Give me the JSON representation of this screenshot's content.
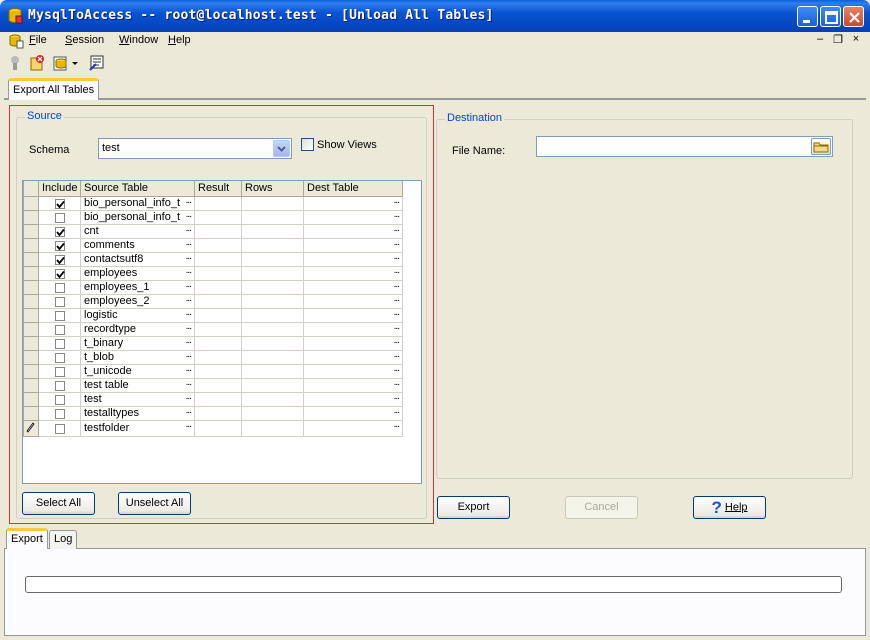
{
  "window": {
    "title": "MysqlToAccess -- root@localhost.test - [Unload All Tables]"
  },
  "menu": {
    "items": [
      "File",
      "Session",
      "Window",
      "Help"
    ],
    "mdi_min": "–",
    "mdi_restore": "❐",
    "mdi_close": "×"
  },
  "toolbar": {
    "icons": [
      "connect-icon",
      "disconnect-icon",
      "new-session-icon",
      "dropdown-arrow-icon",
      "export-icon"
    ]
  },
  "tabs": {
    "main": "Export All Tables",
    "bottom": [
      "Export",
      "Log"
    ]
  },
  "source": {
    "title": "Source",
    "schema_label": "Schema",
    "schema_value": "test",
    "show_views_label": "Show Views",
    "show_views_checked": false,
    "columns": [
      "",
      "Include",
      "Source Table",
      "Result",
      "Rows",
      "Dest Table"
    ],
    "ellipsis": "...",
    "rows": [
      {
        "include": true,
        "source": "bio_personal_info_t",
        "result": "",
        "rows": "",
        "dest": ""
      },
      {
        "include": false,
        "source": "bio_personal_info_t",
        "result": "",
        "rows": "",
        "dest": ""
      },
      {
        "include": true,
        "source": "cnt",
        "result": "",
        "rows": "",
        "dest": ""
      },
      {
        "include": true,
        "source": "comments",
        "result": "",
        "rows": "",
        "dest": ""
      },
      {
        "include": true,
        "source": "contactsutf8",
        "result": "",
        "rows": "",
        "dest": ""
      },
      {
        "include": true,
        "source": "employees",
        "result": "",
        "rows": "",
        "dest": ""
      },
      {
        "include": false,
        "source": "employees_1",
        "result": "",
        "rows": "",
        "dest": ""
      },
      {
        "include": false,
        "source": "employees_2",
        "result": "",
        "rows": "",
        "dest": ""
      },
      {
        "include": false,
        "source": "logistic",
        "result": "",
        "rows": "",
        "dest": ""
      },
      {
        "include": false,
        "source": "recordtype",
        "result": "",
        "rows": "",
        "dest": ""
      },
      {
        "include": false,
        "source": "t_binary",
        "result": "",
        "rows": "",
        "dest": ""
      },
      {
        "include": false,
        "source": "t_blob",
        "result": "",
        "rows": "",
        "dest": ""
      },
      {
        "include": false,
        "source": "t_unicode",
        "result": "",
        "rows": "",
        "dest": ""
      },
      {
        "include": false,
        "source": "test table",
        "result": "",
        "rows": "",
        "dest": ""
      },
      {
        "include": false,
        "source": "test",
        "result": "",
        "rows": "",
        "dest": ""
      },
      {
        "include": false,
        "source": "testalltypes",
        "result": "",
        "rows": "",
        "dest": ""
      },
      {
        "include": false,
        "source": "testfolder",
        "result": "",
        "rows": "",
        "dest": "",
        "editing": true
      }
    ],
    "select_all": "Select All",
    "unselect_all": "Unselect All"
  },
  "destination": {
    "title": "Destination",
    "file_name_label": "File Name:",
    "file_name_value": ""
  },
  "actions": {
    "export": "Export",
    "cancel": "Cancel",
    "help": "Help"
  },
  "progress": {
    "value": 0
  },
  "colors": {
    "accent": "#0046d5",
    "highlight_outline": "#d8323c",
    "tab_hot": "#ffc83c"
  }
}
